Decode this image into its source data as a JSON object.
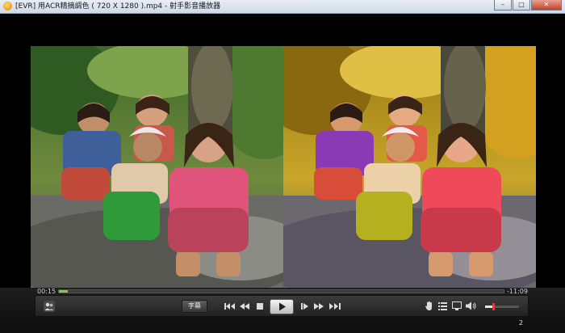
{
  "window": {
    "title": "[EVR] 用ACR精摘調色 ( 720 X 1280 ).mp4 - 射手影音播放器",
    "min_label": "–",
    "max_label": "□",
    "close_label": "✕"
  },
  "player": {
    "time_current": "00:15",
    "time_remaining": "-11:09",
    "progress_fraction": 0.02,
    "volume_fraction": 0.22,
    "subtitle_label": "字幕",
    "page_number": "2"
  },
  "icons": {
    "app": "player-app-icon",
    "people": "people-icon",
    "skip_start": "skip-start-icon",
    "rewind": "rewind-icon",
    "stop": "stop-icon",
    "play": "play-icon",
    "step_forward": "step-forward-icon",
    "fast_forward": "fast-forward-icon",
    "skip_end": "skip-end-icon",
    "hand": "hand-icon",
    "playlist": "playlist-icon",
    "screen": "screen-icon",
    "volume": "volume-icon"
  },
  "colors": {
    "progress": "#7ad03a",
    "volume_knob": "#e23b3b"
  }
}
